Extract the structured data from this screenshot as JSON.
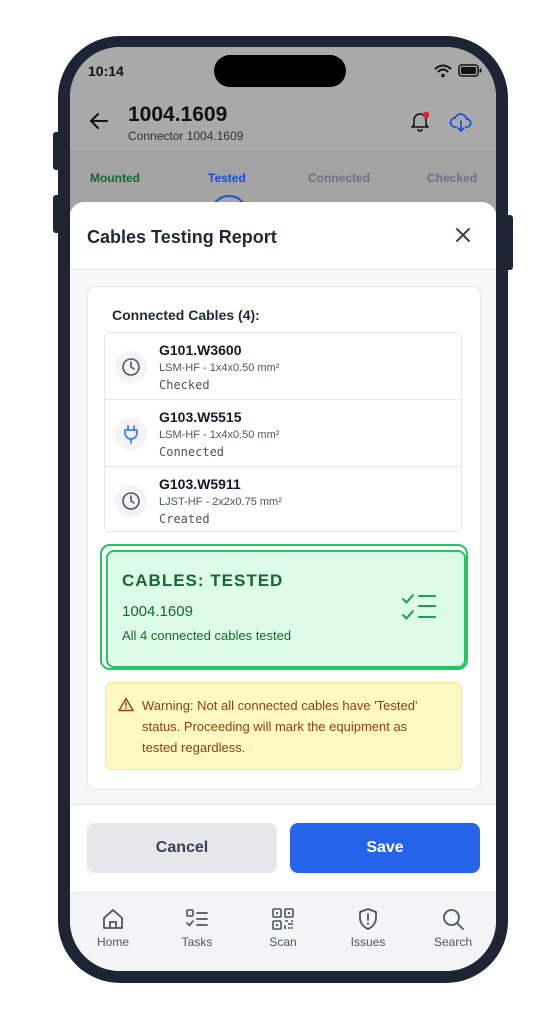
{
  "status_bar": {
    "time": "10:14"
  },
  "header": {
    "title": "1004.1609",
    "subtitle": "Connector 1004.1609"
  },
  "tabs": [
    {
      "label": "Mounted",
      "color": "#166534"
    },
    {
      "label": "Tested",
      "color": "#1d4ed8"
    },
    {
      "label": "Connected",
      "color": "#6b7280"
    },
    {
      "label": "Checked",
      "color": "#6b7280"
    }
  ],
  "sheet": {
    "title": "Cables Testing Report",
    "section_label": "Connected Cables (4):",
    "cables": [
      {
        "name": "G101.W3600",
        "spec": "LSM-HF - 1x4x0.50 mm²",
        "status": "Checked",
        "icon": "clock-icon"
      },
      {
        "name": "G103.W5515",
        "spec": "LSM-HF - 1x4x0.50 mm²",
        "status": "Connected",
        "icon": "plug-icon"
      },
      {
        "name": "G103.W5911",
        "spec": "LJST-HF - 2x2x0.75 mm²",
        "status": "Created",
        "icon": "clock-icon"
      }
    ],
    "tested_card": {
      "title": "CABLES: TESTED",
      "id": "1004.1609",
      "subtitle": "All 4 connected cables tested",
      "icon": "checklist-icon"
    },
    "warning": {
      "text": "Warning: Not all connected cables have 'Tested' status. Proceeding will mark the equipment as tested regardless.",
      "icon": "warning-triangle-icon"
    },
    "buttons": {
      "cancel": "Cancel",
      "save": "Save"
    }
  },
  "bottom_nav": [
    {
      "label": "Home",
      "icon": "home-icon"
    },
    {
      "label": "Tasks",
      "icon": "tasks-icon"
    },
    {
      "label": "Scan",
      "icon": "qr-scan-icon"
    },
    {
      "label": "Issues",
      "icon": "shield-alert-icon"
    },
    {
      "label": "Search",
      "icon": "search-icon"
    }
  ],
  "colors": {
    "accent": "#2563eb",
    "success": "#22c55e",
    "warning_bg": "#fef9c3"
  }
}
